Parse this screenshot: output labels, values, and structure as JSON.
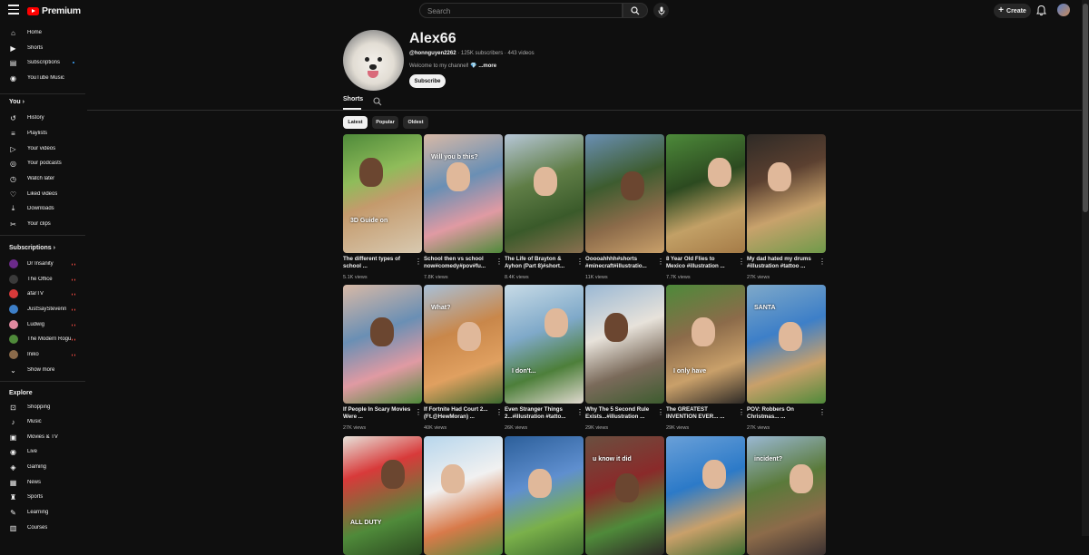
{
  "header": {
    "logo_text": "Premium",
    "search_placeholder": "Search",
    "create_label": "Create"
  },
  "sidebar": {
    "main": [
      {
        "label": "Home",
        "icon": "home-icon"
      },
      {
        "label": "Shorts",
        "icon": "shorts-icon"
      },
      {
        "label": "Subscriptions",
        "icon": "subscriptions-icon"
      },
      {
        "label": "YouTube Music",
        "icon": "youtube-music-icon"
      }
    ],
    "you_label": "You",
    "you": [
      {
        "label": "History",
        "icon": "history-icon"
      },
      {
        "label": "Playlists",
        "icon": "playlists-icon"
      },
      {
        "label": "Your videos",
        "icon": "your-videos-icon"
      },
      {
        "label": "Your podcasts",
        "icon": "podcasts-icon"
      },
      {
        "label": "Watch later",
        "icon": "watch-later-icon"
      },
      {
        "label": "Liked videos",
        "icon": "liked-icon"
      },
      {
        "label": "Downloads",
        "icon": "download-icon"
      },
      {
        "label": "Your clips",
        "icon": "clips-icon"
      }
    ],
    "subscriptions_label": "Subscriptions",
    "subscriptions": [
      {
        "label": "Dr Insanity",
        "color": "#6b2a8a"
      },
      {
        "label": "The Office",
        "color": "#3a3a3a"
      },
      {
        "label": "afarTV",
        "color": "#d83a3a"
      },
      {
        "label": "JustSayStevenn",
        "color": "#3d7fc8"
      },
      {
        "label": "Ludwig",
        "color": "#e08aa0"
      },
      {
        "label": "The Modern Rogue",
        "color": "#4f8a3a"
      },
      {
        "label": "Iniko",
        "color": "#8a6a4a"
      }
    ],
    "show_more": "Show more",
    "explore_label": "Explore",
    "explore": [
      {
        "label": "Shopping",
        "icon": "shopping-icon"
      },
      {
        "label": "Music",
        "icon": "music-icon"
      },
      {
        "label": "Movies & TV",
        "icon": "movies-icon"
      },
      {
        "label": "Live",
        "icon": "live-icon"
      },
      {
        "label": "Gaming",
        "icon": "gaming-icon"
      },
      {
        "label": "News",
        "icon": "news-icon"
      },
      {
        "label": "Sports",
        "icon": "sports-icon"
      },
      {
        "label": "Learning",
        "icon": "learning-icon"
      },
      {
        "label": "Courses",
        "icon": "courses-icon"
      }
    ]
  },
  "channel": {
    "name": "Alex66",
    "handle": "@honnguyen2262",
    "stats": "· 125K subscribers · 443 videos",
    "description": "Welcome to my channel! 💎",
    "more": "...more",
    "subscribe": "Subscribe"
  },
  "tabs": {
    "shorts": "Shorts"
  },
  "chips": [
    "Latest",
    "Popular",
    "Oldest"
  ],
  "shorts": [
    {
      "title": "The different types of school ...",
      "views": "5.1K views",
      "scene": "sc-a",
      "overlay": "3D Guide on"
    },
    {
      "title": "School then vs school now#comedy#pov#fu...",
      "views": "7.8K views",
      "scene": "sc-g",
      "overlay": "Will you b this?"
    },
    {
      "title": "The Life of Brayton & Ayhon (Part 8)#short...",
      "views": "8.4K views",
      "scene": "sc-c",
      "overlay": ""
    },
    {
      "title": "Ooooahhhh#shorts #minecraft#illustratio...",
      "views": "11K views",
      "scene": "sc-d",
      "overlay": ""
    },
    {
      "title": "8 Year Old Flies to Mexico #illustration ...",
      "views": "7.7K views",
      "scene": "sc-e",
      "overlay": ""
    },
    {
      "title": "My dad hated my drums #illustration #tattoo ...",
      "views": "27K views",
      "scene": "sc-f",
      "overlay": ""
    },
    {
      "title": "If People In Scary Movies Were ...",
      "views": "27K views",
      "scene": "sc-g",
      "overlay": ""
    },
    {
      "title": "If Fortnite Had Court 2... (Ft.@HewMoran) ...",
      "views": "40K views",
      "scene": "sc-h",
      "overlay": "What?"
    },
    {
      "title": "Even Stranger Things 2...#illustration #tatto...",
      "views": "26K views",
      "scene": "sc-i",
      "overlay": "I don't..."
    },
    {
      "title": "Why The 5 Second Rule Exists...#illustration ...",
      "views": "29K views",
      "scene": "sc-j",
      "overlay": ""
    },
    {
      "title": "The GREATEST INVENTION EVER... ...",
      "views": "29K views",
      "scene": "sc-k",
      "overlay": "I only have"
    },
    {
      "title": "POV: Robbers On Christmas... ...",
      "views": "27K views",
      "scene": "sc-l",
      "overlay": "SANTA"
    },
    {
      "title": "",
      "views": "",
      "scene": "sc-m",
      "overlay": "ALL DUTY"
    },
    {
      "title": "",
      "views": "",
      "scene": "sc-n",
      "overlay": ""
    },
    {
      "title": "",
      "views": "",
      "scene": "sc-o",
      "overlay": ""
    },
    {
      "title": "",
      "views": "",
      "scene": "sc-p",
      "overlay": "u know it did"
    },
    {
      "title": "",
      "views": "",
      "scene": "sc-q",
      "overlay": ""
    },
    {
      "title": "",
      "views": "",
      "scene": "sc-r",
      "overlay": "incident?"
    }
  ]
}
